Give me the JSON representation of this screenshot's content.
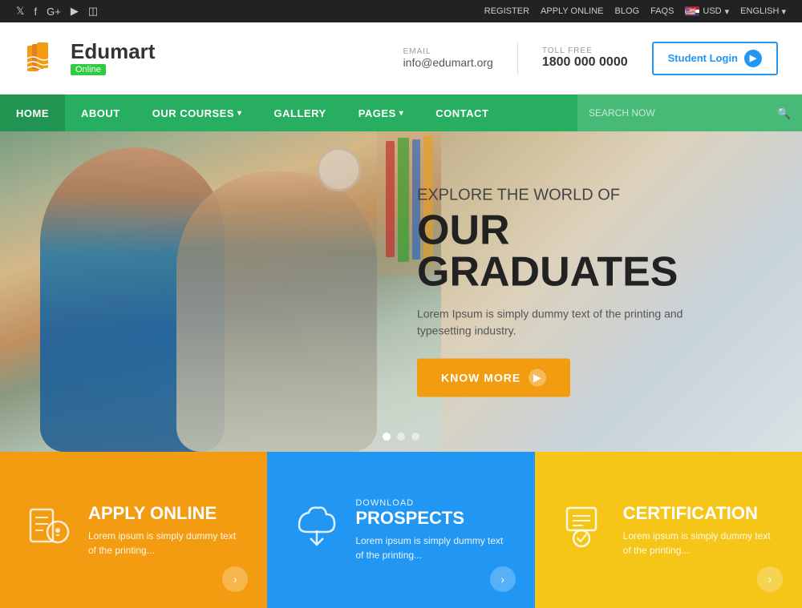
{
  "topbar": {
    "social": [
      "twitter",
      "facebook",
      "google-plus",
      "youtube",
      "instagram"
    ],
    "links": [
      "REGISTER",
      "APPLY ONLINE",
      "BLOG",
      "FAQS"
    ],
    "currency": "USD",
    "language": "ENGLISH"
  },
  "header": {
    "logo_name": "Edumart",
    "logo_sub": "Online",
    "email_label": "EMAIL",
    "email_value": "info@edumart.org",
    "phone_label": "TOLL FREE",
    "phone_value": "1800 000 0000",
    "login_btn": "Student Login"
  },
  "nav": {
    "items": [
      {
        "label": "HOME",
        "has_dropdown": false
      },
      {
        "label": "ABOUT",
        "has_dropdown": false
      },
      {
        "label": "OUR COURSES",
        "has_dropdown": true
      },
      {
        "label": "GALLERY",
        "has_dropdown": false
      },
      {
        "label": "PAGES",
        "has_dropdown": true
      },
      {
        "label": "CONTACT",
        "has_dropdown": false
      }
    ],
    "search_placeholder": "SEARCH NOW"
  },
  "hero": {
    "subtitle": "EXPLORE THE WORLD OF",
    "title": "OUR GRADUATES",
    "desc_line1": "Lorem Ipsum is simply dummy text of the printing and",
    "desc_line2": "typesetting industry.",
    "cta_btn": "KNOW MORE"
  },
  "cards": [
    {
      "id": "apply-online",
      "small_label": "",
      "title": "APPLY ONLINE",
      "desc": "Lorem ipsum is simply dummy text of the printing...",
      "color": "orange",
      "icon": "mouse"
    },
    {
      "id": "download-prospects",
      "small_label": "DOWNLOAD",
      "title": "PROSPECTS",
      "desc": "Lorem ipsum is simply dummy text of the printing...",
      "color": "blue",
      "icon": "cloud-download"
    },
    {
      "id": "certification",
      "small_label": "",
      "title": "CERTIFICATION",
      "desc": "Lorem ipsum is simply dummy text of the printing...",
      "color": "yellow",
      "icon": "certificate"
    }
  ]
}
